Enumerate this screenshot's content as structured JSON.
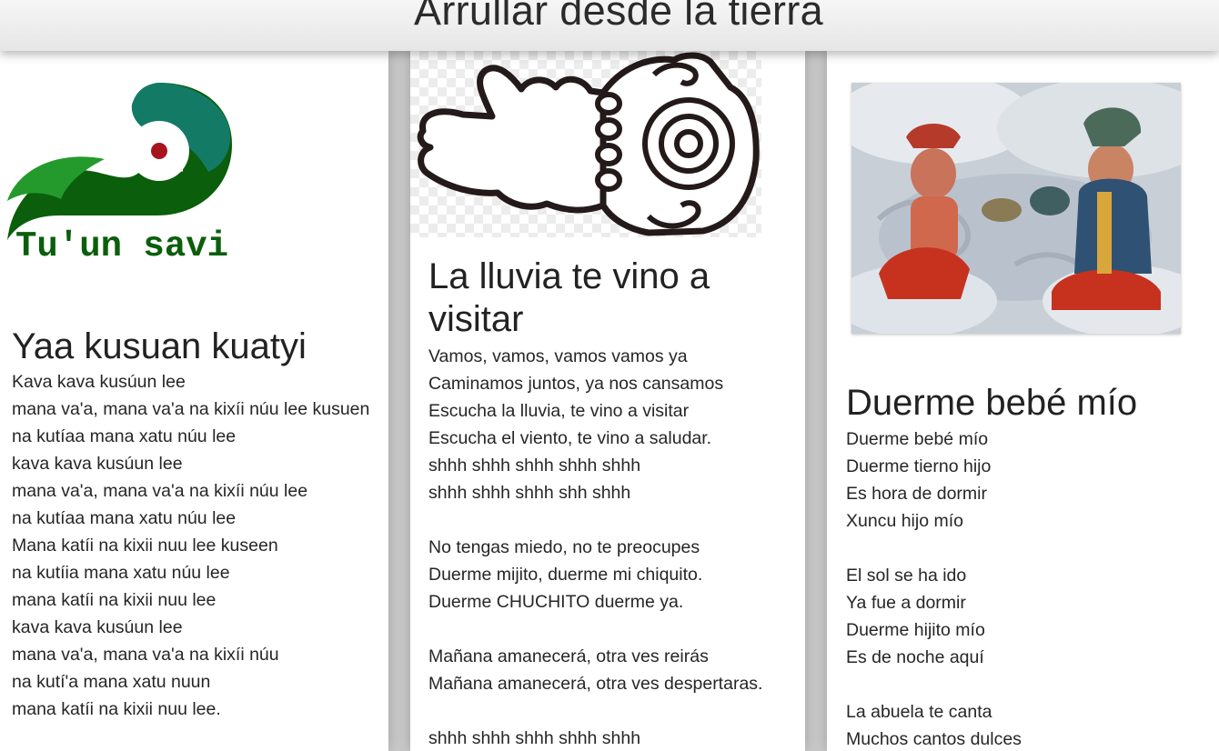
{
  "header": {
    "title": "Arrullar desde la tierra"
  },
  "cards": [
    {
      "logo_text": "Tu'un savi",
      "title": "Yaa kusuan kuatyi",
      "lines": [
        "Kava kava kusúun lee",
        "mana va'a, mana va'a na kixíi núu lee kusuen",
        "na kutíaa mana xatu núu lee",
        "kava kava kusúun lee",
        "mana va'a, mana va'a na kixíi núu lee",
        "na kutíaa mana xatu núu lee",
        "Mana katíi na kixii nuu lee kuseen",
        "na kutíia mana xatu núu lee",
        "mana katíi na kixii nuu lee",
        "kava kava kusúun lee",
        "mana va'a, mana va'a na kixíi núu",
        "na kutí'a mana xatu nuun",
        "mana katíi na kixii nuu lee."
      ]
    },
    {
      "title_line1": "La lluvia te vino a",
      "title_line2": "visitar",
      "lines": [
        "Vamos, vamos, vamos vamos ya",
        "Caminamos juntos, ya nos cansamos",
        "Escucha la lluvia, te vino a visitar",
        "Escucha el viento, te vino a saludar.",
        "shhh shhh shhh shhh shhh",
        "shhh shhh shhh shh shhh",
        "",
        "No tengas miedo, no te preocupes",
        "Duerme mijito, duerme mi chiquito.",
        "Duerme CHUCHITO duerme ya.",
        "",
        "Mañana amanecerá, otra ves reirás",
        "Mañana amanecerá, otra ves despertaras.",
        "",
        "shhh shhh shhh shhh shhh"
      ]
    },
    {
      "title": "Duerme bebé mío",
      "lines": [
        "Duerme bebé mío",
        "Duerme tierno hijo",
        "Es hora de dormir",
        "Xuncu hijo mío",
        "",
        "El sol se ha ido",
        "Ya fue a dormir",
        "Duerme hijito mío",
        "Es de noche aquí",
        "",
        "La abuela te canta",
        "Muchos cantos dulces"
      ]
    }
  ],
  "colors": {
    "logo_dark_green": "#0b5e0b",
    "logo_light_green": "#249a2c",
    "logo_teal": "#137a66",
    "logo_red": "#a8141d",
    "glyph_ink": "#241a1a",
    "background": "#c9c9c9"
  },
  "icons": [
    "tuun-savi-logo",
    "mixtec-hand-glyph",
    "mural-painting"
  ]
}
